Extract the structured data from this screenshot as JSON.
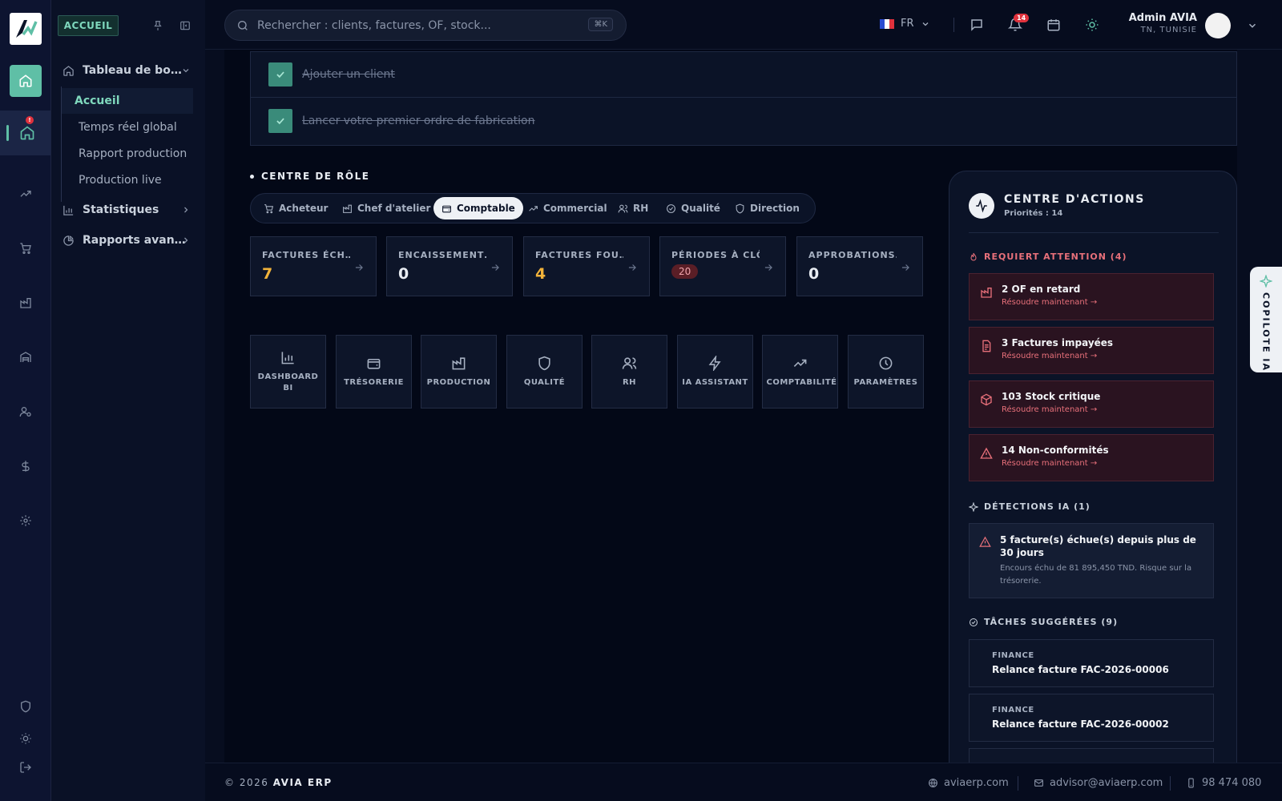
{
  "sidebar": {
    "header": "ACCUEIL",
    "group_dashboard": "Tableau de bo…",
    "items": [
      "Accueil",
      "Temps réel global",
      "Rapport production",
      "Production live"
    ],
    "group_stats": "Statistiques",
    "group_reports": "Rapports avan…",
    "notif_mark": "!"
  },
  "topbar": {
    "search_placeholder": "Rechercher : clients, factures, OF, stock...",
    "search_shortcut": "⌘K",
    "language": "FR",
    "notifications_count": "14",
    "user_name": "Admin AVIA",
    "user_location": "TN, TUNISIE"
  },
  "checklist": [
    {
      "label": "Ajouter un client",
      "done": true
    },
    {
      "label": "Lancer votre premier ordre de fabrication",
      "done": true
    }
  ],
  "role_center": {
    "title": "CENTRE DE RÔLE",
    "tabs": [
      "Acheteur",
      "Chef d'atelier",
      "Comptable",
      "Commercial",
      "RH",
      "Qualité",
      "Direction"
    ],
    "active_tab": "Comptable"
  },
  "kpis": [
    {
      "label": "FACTURES ÉCH…",
      "value": "7",
      "style": "yellow"
    },
    {
      "label": "ENCAISSEMENT…",
      "value": "0",
      "style": "white"
    },
    {
      "label": "FACTURES FOU…",
      "value": "4",
      "style": "yellow"
    },
    {
      "label": "PÉRIODES À CLÔT…",
      "value": "20",
      "style": "pill"
    },
    {
      "label": "APPROBATIONS…",
      "value": "0",
      "style": "white"
    }
  ],
  "modules": [
    "DASHBOARD BI",
    "TRÉSORERIE",
    "PRODUCTION",
    "QUALITÉ",
    "RH",
    "IA ASSISTANT",
    "COMPTABILITÉ",
    "PARAMÈTRES"
  ],
  "action_center": {
    "title": "CENTRE D'ACTIONS",
    "subtitle": "Priorités : 14",
    "attention_title": "REQUIERT ATTENTION (4)",
    "alerts": [
      {
        "title": "2 OF en retard",
        "link": "Résoudre maintenant →"
      },
      {
        "title": "3 Factures impayées",
        "link": "Résoudre maintenant →"
      },
      {
        "title": "103 Stock critique",
        "link": "Résoudre maintenant →"
      },
      {
        "title": "14 Non-conformités",
        "link": "Résoudre maintenant →"
      }
    ],
    "ia_title": "DÉTECTIONS IA (1)",
    "ia_card": {
      "title": "5 facture(s) échue(s) depuis plus de 30 jours",
      "desc": "Encours échu de 81 895,450 TND. Risque sur la trésorerie."
    },
    "tasks_title": "TÂCHES SUGGÉRÉES (9)",
    "tasks": [
      {
        "category": "FINANCE",
        "title": "Relance facture FAC-2026-00006"
      },
      {
        "category": "FINANCE",
        "title": "Relance facture FAC-2026-00002"
      }
    ]
  },
  "copilot_label": "COPILOTE IA",
  "footer": {
    "copyright_prefix": "© 2026",
    "brand": "AVIA ERP",
    "website": "aviaerp.com",
    "email": "advisor@aviaerp.com",
    "phone": "98 474 080"
  },
  "colors": {
    "accent": "#5fbfa6",
    "danger": "#e0323d",
    "warning": "#f2b33a",
    "background": "#030817"
  }
}
